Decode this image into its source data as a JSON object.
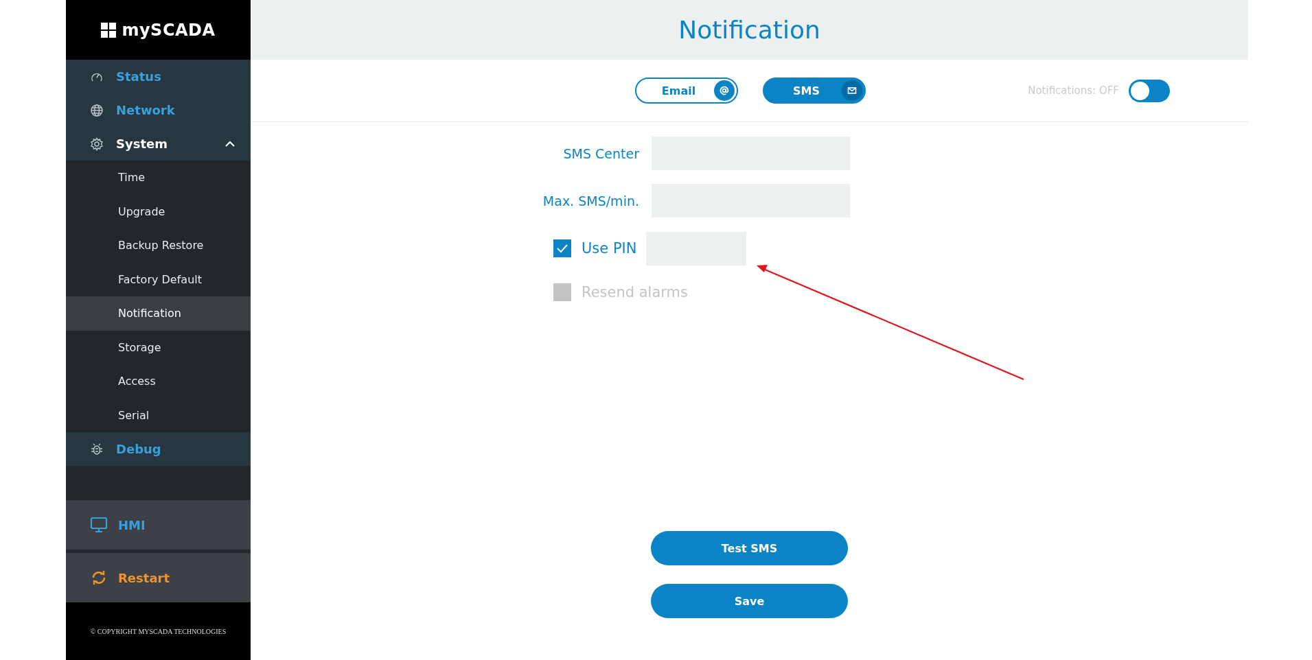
{
  "sidebar": {
    "logo": "mySCADA",
    "items": [
      {
        "label": "Status",
        "kind": "gauge",
        "selected": false
      },
      {
        "label": "Network",
        "kind": "globe",
        "selected": false
      },
      {
        "label": "System",
        "kind": "gear",
        "selected": false,
        "expanded": true,
        "children": [
          {
            "label": "Time",
            "selected": false
          },
          {
            "label": "Upgrade",
            "selected": false
          },
          {
            "label": "Backup Restore",
            "selected": false
          },
          {
            "label": "Factory Default",
            "selected": false
          },
          {
            "label": "Notification",
            "selected": true
          },
          {
            "label": "Storage",
            "selected": false
          },
          {
            "label": "Access",
            "selected": false
          },
          {
            "label": "Serial",
            "selected": false
          }
        ]
      },
      {
        "label": "Debug",
        "kind": "bug",
        "selected": false
      }
    ],
    "bottom_items": [
      {
        "label": "HMI",
        "kind": "monitor",
        "color": "#3aa0dc"
      },
      {
        "label": "Restart",
        "kind": "refresh",
        "color": "#f0922c"
      }
    ],
    "copyright": "© COPYRIGHT MYSCADA TECHNOLOGIES"
  },
  "page": {
    "title": "Notification",
    "channels": [
      {
        "label": "Email",
        "kind": "at",
        "selected": false
      },
      {
        "label": "SMS",
        "kind": "mail",
        "selected": true
      }
    ],
    "notifications": {
      "label": "Notifications: OFF",
      "on": false
    },
    "fields": [
      {
        "label": "SMS Center",
        "kind": "text"
      },
      {
        "label": "Max. SMS/min.",
        "kind": "text"
      },
      {
        "label": "Use PIN",
        "kind": "checkbox-field",
        "checked": true,
        "disabled": false
      },
      {
        "label": "Resend alarms",
        "kind": "checkbox",
        "checked": false,
        "disabled": true
      }
    ],
    "buttons": [
      "Test SMS",
      "Save"
    ]
  }
}
